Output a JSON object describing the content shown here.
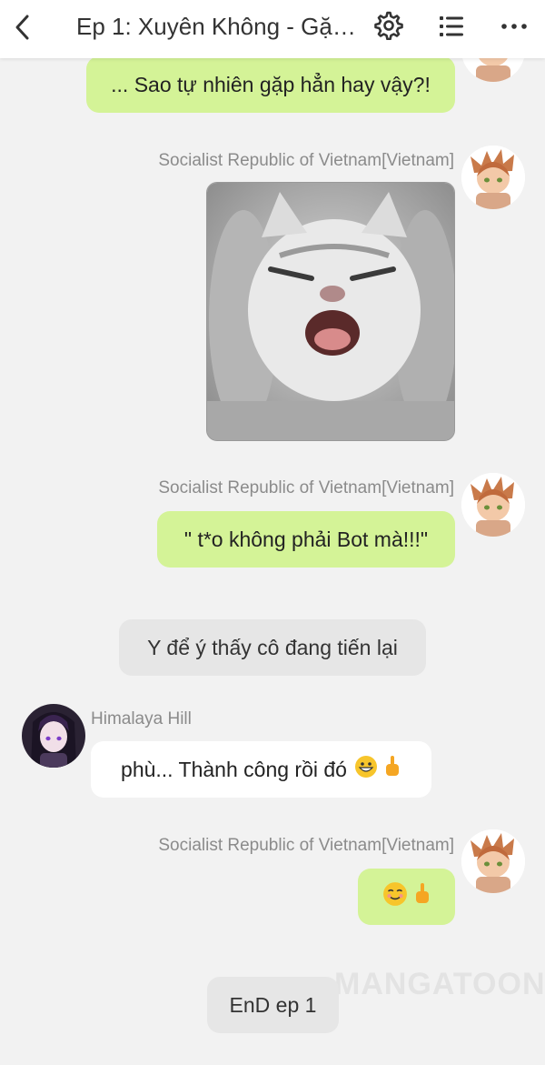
{
  "header": {
    "title": "Ep 1: Xuyên Không - Gặp...",
    "back_icon": "chevron-left-icon",
    "settings_icon": "gear-icon",
    "list_icon": "list-icon",
    "more_icon": "more-horizontal-icon"
  },
  "messages": [
    {
      "type": "text",
      "side": "right",
      "text": "... Sao tự nhiên gặp hẳn hay vậy?!"
    },
    {
      "type": "image",
      "side": "right",
      "sender": "Socialist Republic of Vietnam[Vietnam]",
      "image_desc": "screaming-cat-photo"
    },
    {
      "type": "text",
      "side": "right",
      "sender": "Socialist Republic of Vietnam[Vietnam]",
      "text": "\" t*o không phải Bot mà!!!\""
    },
    {
      "type": "narration",
      "text": "Y để ý thấy cô đang tiến lại"
    },
    {
      "type": "text",
      "side": "left",
      "sender": "Himalaya Hill",
      "text": "phù... Thành công rồi đó"
    },
    {
      "type": "text",
      "side": "right",
      "sender": "Socialist Republic of Vietnam[Vietnam]",
      "text": ""
    },
    {
      "type": "narration",
      "text": "EnD ep 1"
    }
  ],
  "watermark": "MANGATOON",
  "colors": {
    "background": "#f2f2f2",
    "bubble_green": "#d4f397",
    "bubble_white": "#ffffff",
    "bubble_gray": "#e6e6e6",
    "sender_gray": "#8b8b8b"
  }
}
